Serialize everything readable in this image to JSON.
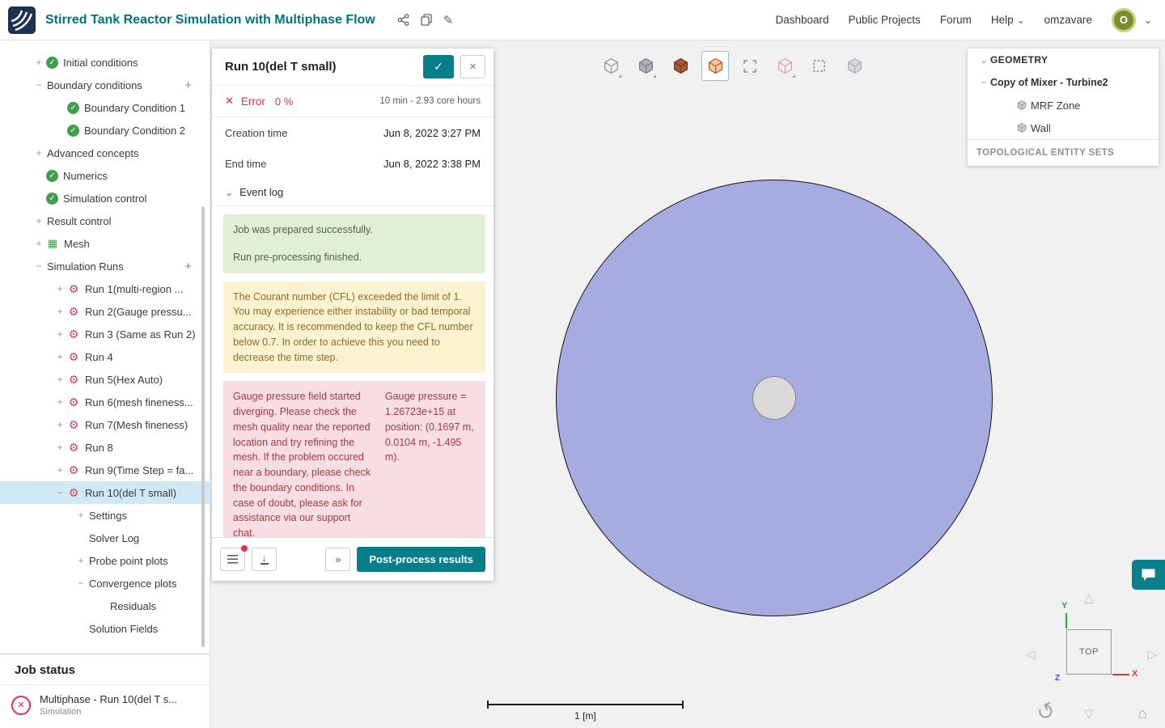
{
  "colors": {
    "accent": "#087e8b",
    "title_teal": "#00737f",
    "error_red": "#e52b50",
    "success_green": "#3da04a",
    "selected_row": "#cfe9f7",
    "tank_fill": "#a7ace0"
  },
  "icons": {
    "confirm": "✓",
    "close": "×",
    "edit": "✎",
    "chevron_down": "⌄",
    "more": "»",
    "plus": "+",
    "tri_up": "△",
    "tri_down": "▽",
    "tri_left": "◁",
    "tri_right": "▷",
    "rotate": "↺",
    "home": "⌂"
  },
  "header": {
    "title": "Stirred Tank Reactor Simulation with Multiphase Flow",
    "nav": [
      "Dashboard",
      "Public Projects",
      "Forum",
      "Help"
    ],
    "username": "omzavare",
    "avatar_letter": "O"
  },
  "sidebar": {
    "tree": [
      {
        "label": "Initial conditions",
        "expander": "+",
        "icon": "check-icon",
        "indent": 1
      },
      {
        "label": "Boundary conditions",
        "expander": "-",
        "indent": 1,
        "add": true
      },
      {
        "label": "Boundary Condition 1",
        "icon": "check-icon",
        "indent": 2
      },
      {
        "label": "Boundary Condition 2",
        "icon": "check-icon",
        "indent": 2
      },
      {
        "label": "Advanced concepts",
        "expander": "+",
        "indent": 1
      },
      {
        "label": "Numerics",
        "icon": "check-icon",
        "indent": 1
      },
      {
        "label": "Simulation control",
        "icon": "check-icon",
        "indent": 1
      },
      {
        "label": "Result control",
        "expander": "+",
        "indent": 1
      },
      {
        "label": "Mesh",
        "expander": "+",
        "icon": "mesh-icon",
        "indent": 1
      },
      {
        "label": "Simulation Runs",
        "expander": "-",
        "indent": 1,
        "add": true
      },
      {
        "label": "Run 1(multi-region ...",
        "expander": "+",
        "icon": "run-icon",
        "indent": 2
      },
      {
        "label": "Run 2(Gauge pressu...",
        "expander": "+",
        "icon": "run-icon",
        "indent": 2
      },
      {
        "label": "Run 3 (Same as Run 2)",
        "expander": "+",
        "icon": "run-icon",
        "indent": 2
      },
      {
        "label": "Run 4",
        "expander": "+",
        "icon": "run-icon",
        "indent": 2
      },
      {
        "label": "Run 5(Hex Auto)",
        "expander": "+",
        "icon": "run-icon",
        "indent": 2
      },
      {
        "label": "Run 6(mesh fineness...",
        "expander": "+",
        "icon": "run-icon",
        "indent": 2
      },
      {
        "label": "Run 7(Mesh fineness)",
        "expander": "+",
        "icon": "run-icon",
        "indent": 2
      },
      {
        "label": "Run 8",
        "expander": "+",
        "icon": "run-icon",
        "indent": 2
      },
      {
        "label": "Run 9(Time Step = fa...",
        "expander": "+",
        "icon": "run-icon",
        "indent": 2
      },
      {
        "label": "Run 10(del T small)",
        "expander": "-",
        "icon": "run-icon",
        "indent": 2,
        "selected": true
      },
      {
        "label": "Settings",
        "expander": "+",
        "indent": 3
      },
      {
        "label": "Solver Log",
        "indent": 3
      },
      {
        "label": "Probe point plots",
        "expander": "+",
        "indent": 3
      },
      {
        "label": "Convergence plots",
        "expander": "-",
        "indent": 3
      },
      {
        "label": "Residuals",
        "indent": 4
      },
      {
        "label": "Solution Fields",
        "indent": 3
      }
    ],
    "job_status": {
      "title": "Job status",
      "job_name": "Multiphase - Run 10(del T s...",
      "job_type": "Simulation"
    }
  },
  "run_panel": {
    "title": "Run 10(del T small)",
    "status_label": "Error",
    "status_percent": "0 %",
    "status_x": "✕",
    "duration": "10 min - 2.93 core hours",
    "creation_time_label": "Creation time",
    "creation_time": "Jun 8, 2022 3:27 PM",
    "end_time_label": "End time",
    "end_time": "Jun 8, 2022 3:38 PM",
    "event_log_label": "Event log",
    "events": [
      {
        "type": "success",
        "lines": [
          "Job was prepared successfully.",
          "Run pre-processing finished."
        ]
      },
      {
        "type": "warning",
        "lines": [
          "The Courant number (CFL) exceeded the limit of 1. You may experience either instability or bad temporal accuracy. It is recommended to keep the CFL number below 0.7. In order to achieve this you need to decrease the time step."
        ]
      },
      {
        "type": "error",
        "columns": [
          "Gauge pressure field started diverging. Please check the mesh quality near the reported location and try refining the mesh. If the problem occured near a boundary, please check the boundary conditions. In case of doubt, please ask for assistance via our support chat.",
          "Gauge pressure = 1.26723e+15 at position: (0.1697 m, 0.0104 m, -1.495 m)."
        ]
      }
    ],
    "post_process_label": "Post-process results"
  },
  "viewport": {
    "toolbar": [
      {
        "name": "perspective-cube-icon",
        "variant": "cube-outline",
        "dropdown": true
      },
      {
        "name": "solid-shading-cube-icon",
        "variant": "cube-solid",
        "dropdown": true
      },
      {
        "name": "surfaces-cube-icon",
        "variant": "cube-orange-solid",
        "dropdown": false
      },
      {
        "name": "volumes-cube-icon",
        "variant": "cube-orange-outline",
        "dropdown": false,
        "selected": true
      },
      {
        "name": "fit-view-icon",
        "variant": "corners",
        "dropdown": false
      },
      {
        "name": "transparent-cube-icon",
        "variant": "cube-pink-outline",
        "dropdown": true
      },
      {
        "name": "box-select-icon",
        "variant": "dashed-box",
        "dropdown": false
      },
      {
        "name": "hidden-cube-icon",
        "variant": "cube-faded",
        "dropdown": false
      }
    ],
    "geometry_panel": {
      "title": "GEOMETRY",
      "root": "Copy of Mixer - Turbine2",
      "children": [
        "MRF Zone",
        "Wall"
      ],
      "footer": "TOPOLOGICAL ENTITY SETS"
    },
    "scale_label": "1 [m]",
    "gizmo": {
      "top_label": "TOP",
      "x": "X",
      "y": "Y",
      "z": "Z"
    }
  }
}
